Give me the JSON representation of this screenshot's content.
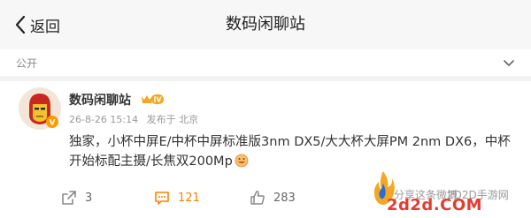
{
  "header": {
    "back_label": "返回",
    "title": "数码闲聊站"
  },
  "visibility": {
    "label": "公开"
  },
  "post": {
    "author": "数码闲聊站",
    "level_badge": "IV",
    "date": "26-8-26 15:14",
    "source_label": "发布于 北京",
    "content": "独家，小杯中屏E/中杯中屏标准版3nm DX5/大大杯大屏PM 2nm DX6，中杯开始标配主摄/长焦双200Mp"
  },
  "actions": {
    "share_count": "3",
    "comment_count": "121",
    "like_count": "283"
  },
  "watermark": {
    "share_text": "分享这条微博",
    "site_name": "2D2D手游网",
    "domain": "2d2d.COM"
  },
  "colors": {
    "accent_orange": "#ff8200",
    "watermark_red": "#e63b2e",
    "icon_gray": "#8a8a8a"
  },
  "icons": {
    "back": "chevron-left-icon",
    "visibility": "chevron-down-icon",
    "share": "share-icon",
    "comment": "comment-icon",
    "like": "thumbs-up-icon"
  }
}
